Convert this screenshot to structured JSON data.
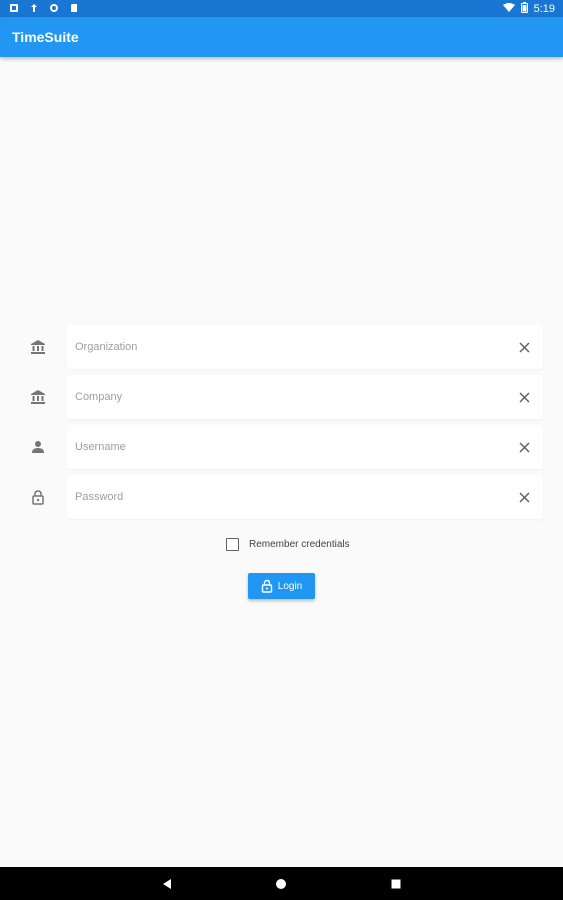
{
  "status_bar": {
    "time": "5:19",
    "left_icons": [
      "notification-icon",
      "upload-icon",
      "sync-icon",
      "sd-card-icon"
    ],
    "right_icons": [
      "wifi-icon",
      "battery-icon"
    ]
  },
  "app_bar": {
    "title": "TimeSuite"
  },
  "form": {
    "fields": [
      {
        "icon": "bank-icon",
        "placeholder": "Organization",
        "value": ""
      },
      {
        "icon": "bank-icon",
        "placeholder": "Company",
        "value": ""
      },
      {
        "icon": "person-icon",
        "placeholder": "Username",
        "value": ""
      },
      {
        "icon": "lock-icon",
        "placeholder": "Password",
        "value": ""
      }
    ],
    "remember_label": "Remember credentials",
    "remember_checked": false,
    "login_label": "Login"
  },
  "nav_bar": {
    "buttons": [
      "back-icon",
      "home-icon",
      "recents-icon"
    ]
  },
  "colors": {
    "status_bar": "#1976d2",
    "app_bar": "#2196f3",
    "background": "#fafafa",
    "accent": "#2196f3"
  }
}
